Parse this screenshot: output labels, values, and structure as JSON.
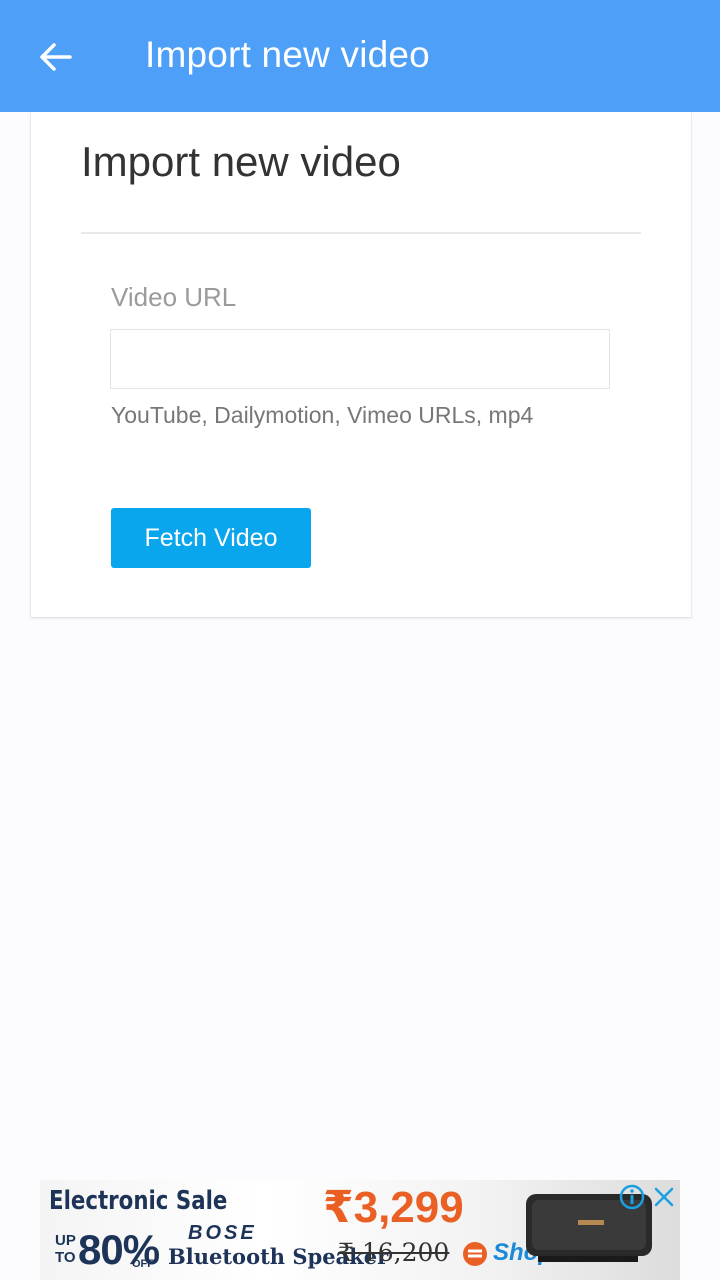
{
  "appbar": {
    "title": "Import new video",
    "back_icon": "arrow-left-icon",
    "color": "#4d9ff7"
  },
  "card": {
    "title": "Import new video",
    "field_label": "Video URL",
    "url_value": "",
    "hint": "YouTube, Dailymotion, Vimeo URLs, mp4",
    "button_label": "Fetch Video",
    "button_color": "#0aa6ed"
  },
  "ad": {
    "headline": "Electronic Sale",
    "upto": "UP TO",
    "discount": "80%",
    "off": "OFF",
    "brand": "BOSE",
    "product": "Bluetooth Speaker",
    "price": "₹3,299",
    "old_price": "₹ 16,200",
    "store": "ShopKart",
    "info_icon": "info-icon",
    "close_icon": "close-icon"
  }
}
